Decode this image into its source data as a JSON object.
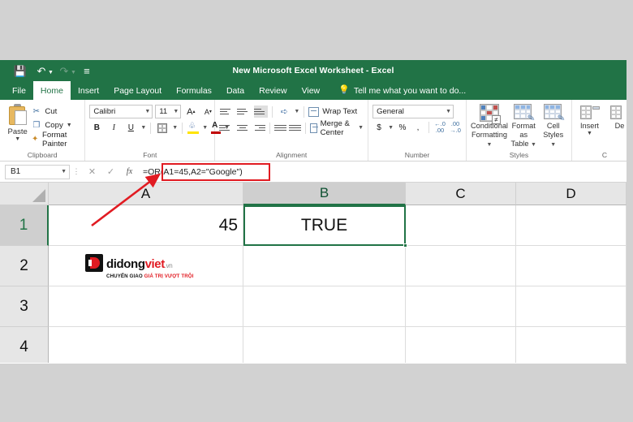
{
  "window": {
    "title": "New Microsoft Excel Worksheet - Excel",
    "accent_green": "#217346",
    "annotation_red": "#e11b22"
  },
  "quick_access": [
    {
      "name": "save-icon",
      "glyph": "💾"
    },
    {
      "name": "undo-icon",
      "glyph": "↶"
    },
    {
      "name": "redo-icon",
      "glyph": "↷"
    },
    {
      "name": "customize-qat-icon",
      "glyph": "≡"
    }
  ],
  "tabs": [
    {
      "label": "File",
      "active": false
    },
    {
      "label": "Home",
      "active": true
    },
    {
      "label": "Insert",
      "active": false
    },
    {
      "label": "Page Layout",
      "active": false
    },
    {
      "label": "Formulas",
      "active": false
    },
    {
      "label": "Data",
      "active": false
    },
    {
      "label": "Review",
      "active": false
    },
    {
      "label": "View",
      "active": false
    }
  ],
  "tell_me": {
    "placeholder": "Tell me what you want to do...",
    "icon": "lightbulb-icon"
  },
  "ribbon": {
    "clipboard": {
      "group_label": "Clipboard",
      "paste_label": "Paste",
      "items": [
        {
          "label": "Cut",
          "icon": "scissors-icon"
        },
        {
          "label": "Copy",
          "icon": "copy-icon"
        },
        {
          "label": "Format Painter",
          "icon": "format-painter-icon"
        }
      ]
    },
    "font": {
      "group_label": "Font",
      "font_name": "Calibri",
      "font_size": "11",
      "bold": "B",
      "italic": "I",
      "underline": "U",
      "grow_font": "A",
      "shrink_font": "A"
    },
    "alignment": {
      "group_label": "Alignment",
      "wrap_text": "Wrap Text",
      "merge_center": "Merge & Center"
    },
    "number": {
      "group_label": "Number",
      "format": "General",
      "currency": "$",
      "percent": "%",
      "comma": ","
    },
    "styles": {
      "group_label": "Styles",
      "conditional_formatting": "Conditional\nFormatting",
      "conditional_formatting_l1": "Conditional",
      "conditional_formatting_l2": "Formatting",
      "format_as_table_l1": "Format as",
      "format_as_table_l2": "Table",
      "cell_styles_l1": "Cell",
      "cell_styles_l2": "Styles"
    },
    "cells": {
      "group_label": "C",
      "insert": "Insert",
      "delete": "De"
    }
  },
  "formula_bar": {
    "name_box": "B1",
    "cancel_icon": "✕",
    "enter_icon": "✓",
    "fx_icon": "fx",
    "formula": "=OR(A1=45,A2=\"Google\")"
  },
  "sheet": {
    "columns": [
      "A",
      "B",
      "C",
      "D"
    ],
    "rows": [
      "1",
      "2",
      "3",
      "4"
    ],
    "selected_cell": "B1",
    "selected_column": "B",
    "selected_row": "1",
    "cells": [
      {
        "ref": "A1",
        "value": "45",
        "align": "right"
      },
      {
        "ref": "B1",
        "value": "TRUE",
        "align": "center"
      }
    ]
  },
  "watermark": {
    "word_1": "didong",
    "word_2": "viet",
    "word_3": ".vn",
    "tagline_1": "CHUYỂN GIAO ",
    "tagline_2": "GIÁ TRỊ VƯỢT TRỘI"
  }
}
